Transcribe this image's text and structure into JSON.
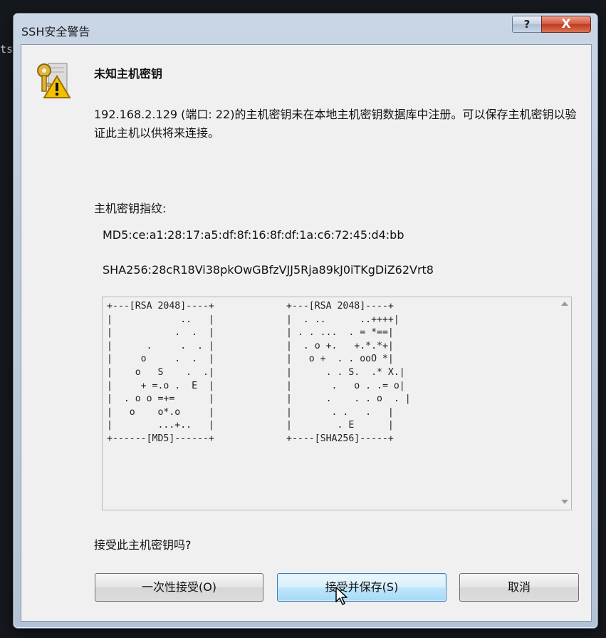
{
  "background": {
    "terminal_fragment": "ts"
  },
  "window": {
    "title": "SSH安全警告",
    "help_label": "?",
    "close_label": "X"
  },
  "content": {
    "heading": "未知主机密钥",
    "description": "192.168.2.129 (端口: 22)的主机密钥未在本地主机密钥数据库中注册。可以保存主机密钥以验证此主机以供将来连接。",
    "fingerprint_label": "主机密钥指纹:",
    "md5": "MD5:ce:a1:28:17:a5:df:8f:16:8f:df:1a:c6:72:45:d4:bb",
    "sha256": "SHA256:28cR18Vi38pkOwGBfzVJJ5Rja89kJ0iTKgDiZ62Vrt8",
    "randomart_md5": "+---[RSA 2048]----+\n|            ..   |\n|           .  .  |\n|      .     .  . |\n|     o     .  .  |\n|    o   S    .  .|\n|     + =.o .  E  |\n|  . o o =+=      |\n|   o    o*.o     |\n|        ...+..   |\n+------[MD5]------+",
    "randomart_sha256": "+---[RSA 2048]----+\n|  . ..      ..++++|\n| . . ...  . = *==|\n|  . o +.   +.*.*+|\n|   o +  . . ooO *|\n|      . . S.  .* X.|\n|       .   o . .= o|\n|      .    . . o  . |\n|       . .   .   |\n|        . E      |\n+----[SHA256]-----+",
    "question": "接受此主机密钥吗?"
  },
  "buttons": {
    "accept_once": "一次性接受(O)",
    "accept_save": "接受并保存(S)",
    "cancel": "取消"
  },
  "colors": {
    "frame": "#bccbdd",
    "client": "#f0f0f0",
    "default_button_border": "#3c7fb1",
    "close_button": "#c8472d"
  },
  "icons": {
    "dialog": "key-warning-icon",
    "pointer": "mouse-pointer-icon"
  }
}
